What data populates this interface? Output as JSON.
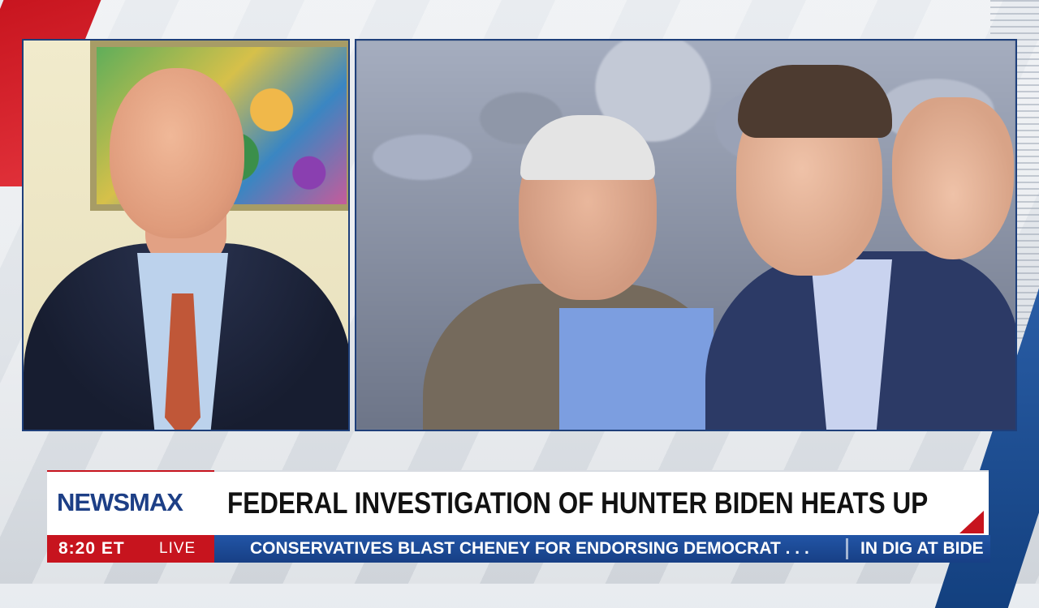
{
  "brand": {
    "logo_text": "NEWSMAX",
    "colors": {
      "brand_blue": "#1d3f86",
      "brand_red": "#c7141e",
      "ticker_blue": "#1e4c9a"
    }
  },
  "lower_third": {
    "headline": "FEDERAL INVESTIGATION OF HUNTER BIDEN HEATS UP",
    "time": "8:20 ET",
    "live_label": "LIVE",
    "ticker_primary": "CONSERVATIVES BLAST CHENEY FOR ENDORSING DEMOCRAT . . .",
    "ticker_secondary": "IN DIG AT BIDE"
  }
}
